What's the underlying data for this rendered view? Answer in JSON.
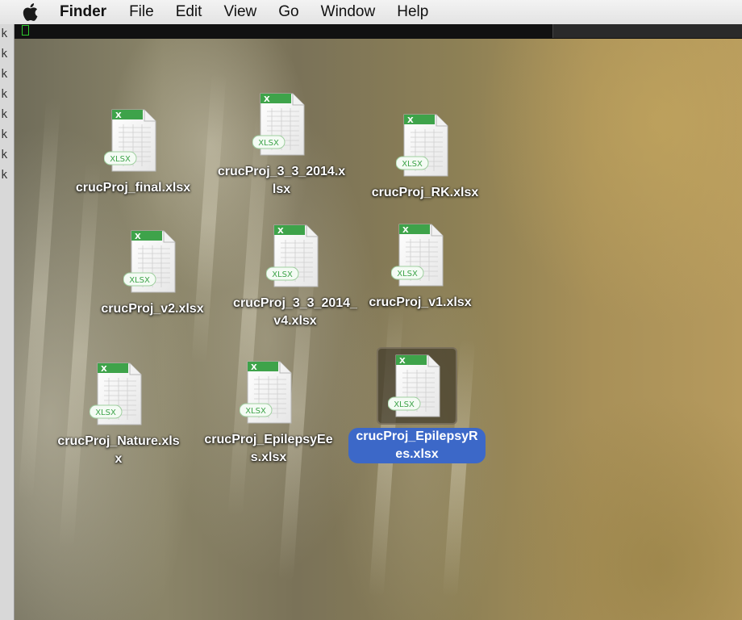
{
  "menubar": {
    "apple_icon": "apple-logo-icon",
    "app_name": "Finder",
    "items": [
      "File",
      "Edit",
      "View",
      "Go",
      "Window",
      "Help"
    ]
  },
  "terminal": {
    "sliver_chars": [
      "k",
      "k",
      "k",
      "k",
      "k",
      "k",
      "k",
      "k"
    ]
  },
  "desktop": {
    "files": [
      {
        "label": "crucProj_final.xlsx",
        "badge": "XLSX",
        "selected": false
      },
      {
        "label": "crucProj_3_3_2014.xlsx",
        "badge": "XLSX",
        "selected": false
      },
      {
        "label": "crucProj_RK.xlsx",
        "badge": "XLSX",
        "selected": false
      },
      {
        "label": "crucProj_v2.xlsx",
        "badge": "XLSX",
        "selected": false
      },
      {
        "label": "crucProj_3_3_2014_v4.xlsx",
        "badge": "XLSX",
        "selected": false
      },
      {
        "label": "crucProj_v1.xlsx",
        "badge": "XLSX",
        "selected": false
      },
      {
        "label": "crucProj_Nature.xlsx",
        "badge": "XLSX",
        "selected": false
      },
      {
        "label": "crucProj_EpilepsyEes.xlsx",
        "badge": "XLSX",
        "selected": false
      },
      {
        "label": "crucProj_EpilepsyRes.xlsx",
        "badge": "XLSX",
        "selected": true
      }
    ]
  },
  "colors": {
    "excel_green": "#3ea34a",
    "selection_blue": "#3c68c8",
    "menubar_bg": "#ececec"
  }
}
